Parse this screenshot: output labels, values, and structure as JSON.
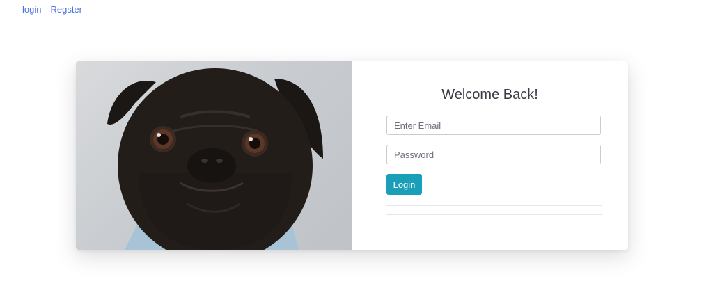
{
  "nav": {
    "login_label": "login",
    "register_label": "Regster"
  },
  "card": {
    "image_icon": "pug-photo",
    "title": "Welcome Back!",
    "email_placeholder": "Enter Email",
    "password_placeholder": "Password",
    "login_button_label": "Login"
  },
  "colors": {
    "link": "#4e73df",
    "button": "#1a9fb8",
    "title_text": "#3a3b45"
  }
}
